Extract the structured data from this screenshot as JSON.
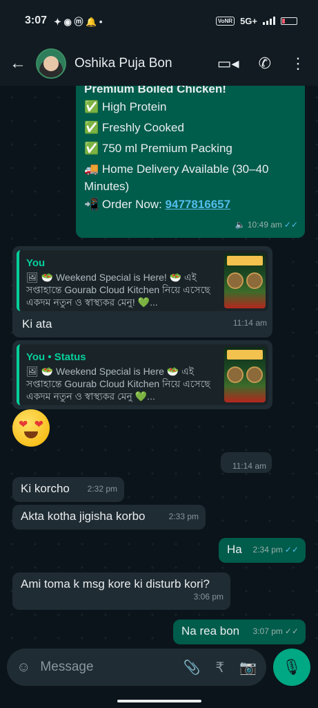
{
  "status": {
    "time": "3:07",
    "network": "5G+",
    "volte": "VoNR"
  },
  "header": {
    "contact_name": "Oshika Puja Bon"
  },
  "messages": {
    "m1": {
      "lines": [
        "Premium Boiled Chicken!",
        "✅ High Protein",
        "✅ Freshly Cooked",
        "✅ 750 ml Premium Packing",
        "🚚 Home Delivery Available (30–40",
        "Minutes)"
      ],
      "order_label": "📲 Order Now: ",
      "phone": "9477816657",
      "time": "10:49 am"
    },
    "m2": {
      "author": "You",
      "quote": "🖼 🥗 Weekend Special is Here! 🥗 এই সপ্তাহান্তে Gourab Cloud Kitchen নিয়ে এসেছে একদম নতুন ও স্বাস্থ্যকর মেনু! 💚...",
      "text": "Ki ata",
      "time": "11:14 am"
    },
    "m3": {
      "author": "You • Status",
      "quote": "🖼 🥗 Weekend Special is Here 🥗 এই সপ্তাহান্তে Gourab Cloud Kitchen নিয়ে এসেছে একদম নতুন ও স্বাস্থ্যকর মেনু 💚..."
    },
    "m4": {
      "time": "11:14 am"
    },
    "m5": {
      "text": "Ki korcho",
      "time": "2:32 pm"
    },
    "m6": {
      "text": "Akta kotha jigisha korbo",
      "time": "2:33 pm"
    },
    "m7": {
      "text": "Ha",
      "time": "2:34 pm"
    },
    "m8": {
      "text": "Ami toma k msg kore ki disturb kori?",
      "time": "3:06 pm"
    },
    "m9": {
      "text": "Na rea bon",
      "time": "3:07 pm"
    }
  },
  "input": {
    "placeholder": "Message"
  },
  "colors": {
    "outgoing": "#005c4b",
    "incoming": "#202c33",
    "accent": "#00a884",
    "read_tick": "#53bdeb"
  }
}
